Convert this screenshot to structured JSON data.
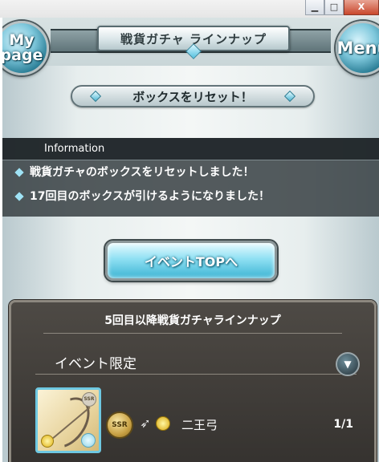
{
  "window": {
    "minimize_glyph": "▁",
    "maximize_glyph": "□",
    "close_glyph": "X"
  },
  "header": {
    "title": "戦貨ガチャ ラインナップ",
    "mypage_line1": "My",
    "mypage_line2": "page",
    "menu_label": "Menu"
  },
  "reset_banner": {
    "label": "ボックスをリセット！"
  },
  "information": {
    "heading": "Information",
    "lines": [
      "戦貨ガチャのボックスをリセットしました！",
      "17回目のボックスが引けるようになりました！"
    ]
  },
  "event_button": {
    "label": "イベントTOPへ"
  },
  "lineup": {
    "title": "5回目以降戦貨ガチャラインナップ",
    "section_label": "イベント限定",
    "items": [
      {
        "rarity": "SSR",
        "name": "二王弓",
        "count": "1/1",
        "weapon_icon": "bow-icon",
        "element_icon": "light-element-icon"
      }
    ]
  },
  "colors": {
    "accent_cyan": "#55c1df",
    "panel_dark": "#3c4448",
    "lineup_bg": "#4e4a45"
  }
}
